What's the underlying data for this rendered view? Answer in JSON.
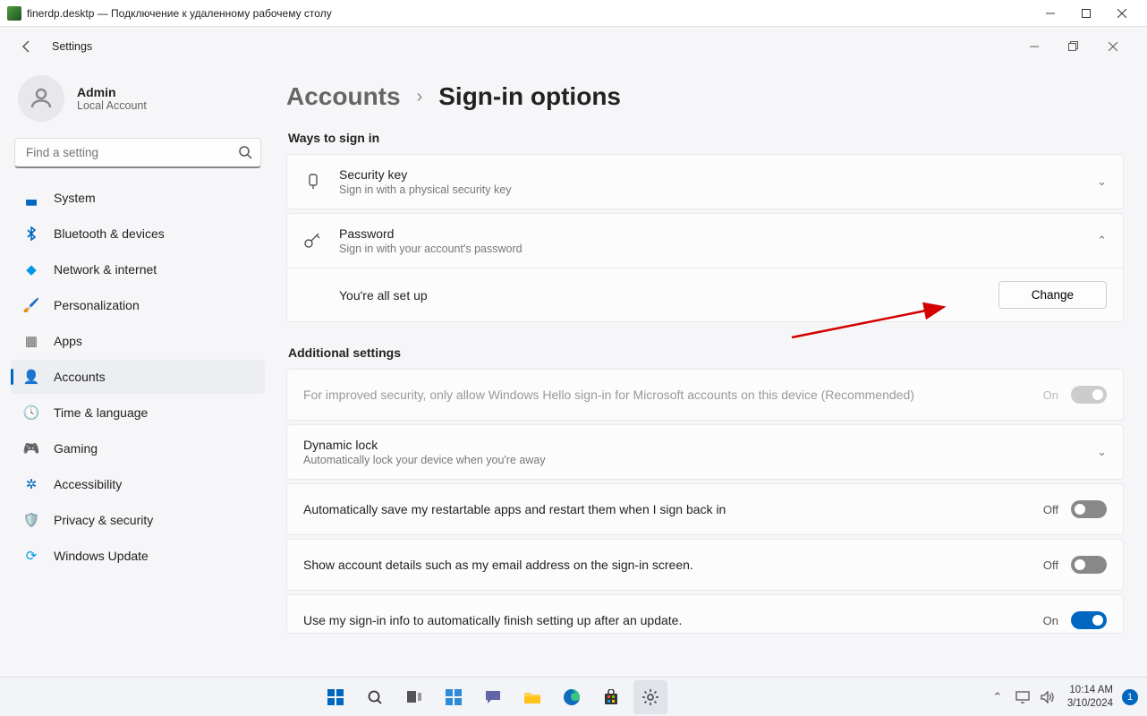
{
  "outer_window": {
    "title": "finerdp.desktp — Подключение к удаленному рабочему столу"
  },
  "settings_window": {
    "title": "Settings",
    "profile": {
      "name": "Admin",
      "subtitle": "Local Account"
    },
    "search_placeholder": "Find a setting",
    "nav": [
      {
        "label": "System",
        "icon": "🖥️"
      },
      {
        "label": "Bluetooth & devices",
        "icon": "bt"
      },
      {
        "label": "Network & internet",
        "icon": "💎"
      },
      {
        "label": "Personalization",
        "icon": "🖌️"
      },
      {
        "label": "Apps",
        "icon": "▦"
      },
      {
        "label": "Accounts",
        "icon": "👤",
        "active": true
      },
      {
        "label": "Time & language",
        "icon": "🌐"
      },
      {
        "label": "Gaming",
        "icon": "🎮"
      },
      {
        "label": "Accessibility",
        "icon": "♿"
      },
      {
        "label": "Privacy & security",
        "icon": "🛡️"
      },
      {
        "label": "Windows Update",
        "icon": "🔄"
      }
    ],
    "breadcrumb": {
      "parent": "Accounts",
      "current": "Sign-in options"
    },
    "sections": {
      "ways_header": "Ways to sign in",
      "additional_header": "Additional settings"
    },
    "signin_methods": [
      {
        "title": "Security key",
        "sub": "Sign in with a physical security key",
        "expanded": false
      },
      {
        "title": "Password",
        "sub": "Sign in with your account's password",
        "expanded": true,
        "status": "You're all set up",
        "action": "Change"
      }
    ],
    "additional": {
      "hello": {
        "label": "For improved security, only allow Windows Hello sign-in for Microsoft accounts on this device (Recommended)",
        "state": "On",
        "disabled": true,
        "on": true
      },
      "dynamic_lock": {
        "title": "Dynamic lock",
        "sub": "Automatically lock your device when you're away"
      },
      "restart_apps": {
        "label": "Automatically save my restartable apps and restart them when I sign back in",
        "state": "Off",
        "on": false
      },
      "account_details": {
        "label": "Show account details such as my email address on the sign-in screen.",
        "state": "Off",
        "on": false
      },
      "finish_setup": {
        "label": "Use my sign-in info to automatically finish setting up after an update.",
        "state": "On",
        "on": true
      }
    }
  },
  "taskbar": {
    "time": "10:14 AM",
    "date": "3/10/2024",
    "notif_count": "1"
  }
}
